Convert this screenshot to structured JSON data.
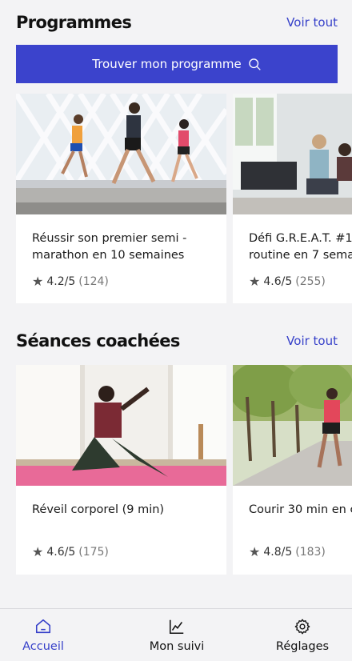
{
  "programmes": {
    "title": "Programmes",
    "see_all": "Voir tout",
    "find_button": "Trouver mon programme",
    "cards": [
      {
        "title": "Réussir son premier semi -\nmarathon en 10 semaines",
        "rating": "4.2/5",
        "count": "(124)"
      },
      {
        "title": "Défi G.R.E.A.T. #1 :\nroutine en 7 sema",
        "rating": "4.6/5",
        "count": "(255)"
      }
    ]
  },
  "coached": {
    "title": "Séances coachées",
    "see_all": "Voir tout",
    "cards": [
      {
        "title": "Réveil corporel (9 min)",
        "rating": "4.6/5",
        "count": "(175)"
      },
      {
        "title": "Courir 30 min en c",
        "rating": "4.8/5",
        "count": "(183)"
      }
    ]
  },
  "nav": {
    "items": [
      {
        "label": "Accueil",
        "icon": "home-icon",
        "active": true
      },
      {
        "label": "Mon suivi",
        "icon": "chart-icon",
        "active": false
      },
      {
        "label": "Réglages",
        "icon": "gear-icon",
        "active": false
      }
    ]
  },
  "colors": {
    "accent": "#3b43cc",
    "link": "#3640c9",
    "background": "#f3f3f5"
  }
}
